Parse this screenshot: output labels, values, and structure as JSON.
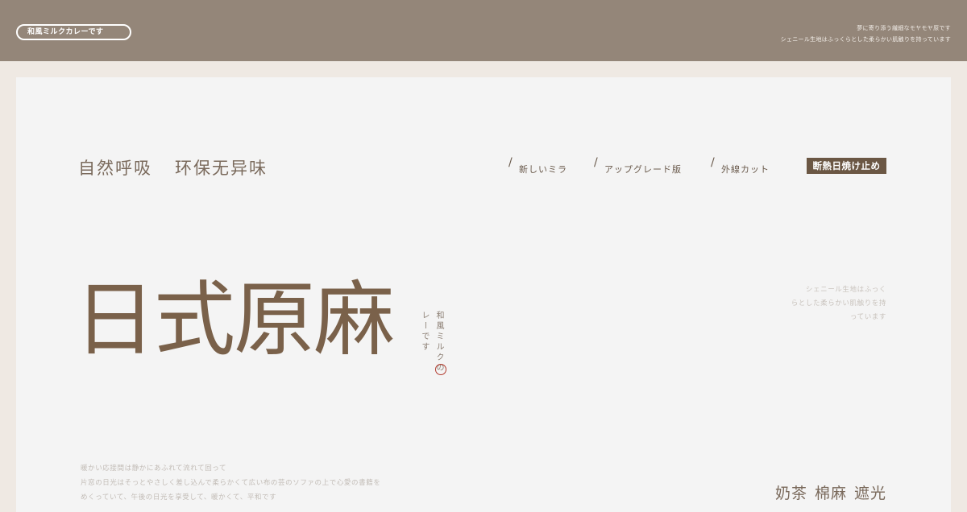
{
  "header": {
    "pill_label": "和風ミルクカレーです",
    "right_lines": [
      "夢に寄り添う繊細なモヤモヤ原です",
      "シェニール生地はふっくらとした柔らかい肌触りを持っています"
    ]
  },
  "hero": {
    "tagline": [
      "自然呼吸",
      "环保无异味"
    ],
    "nav_items": [
      "新しいミラ",
      "アップグレード版",
      "外線カット"
    ],
    "nav_separator": "/",
    "badge": "断熱日焼け止め",
    "title": "日式原麻",
    "vertical_col1": "和風ミルクの",
    "vertical_col2": "レーです",
    "side_desc": [
      "シェニール生地はふっく",
      "らとした柔らかい肌触りを持",
      "っています"
    ],
    "bottom_desc": [
      "暖かい応接間は静かにあふれて流れて回って",
      "片窓の日光はそっとやさしく差し込んで柔らかくて広い布の芸のソファの上で心愛の書籍を",
      "めくっていて、午後の日光を享受して、暖かくて、平和です"
    ],
    "bottom_keywords": [
      "奶茶",
      "棉麻",
      "遮光"
    ]
  },
  "colors": {
    "topbar": "#948679",
    "page_bg": "#efe9e3",
    "panel_bg": "#f4f4f4",
    "title_brown": "#7a614a",
    "badge_bg": "#6b5744",
    "accent_red": "#b23a2e"
  }
}
